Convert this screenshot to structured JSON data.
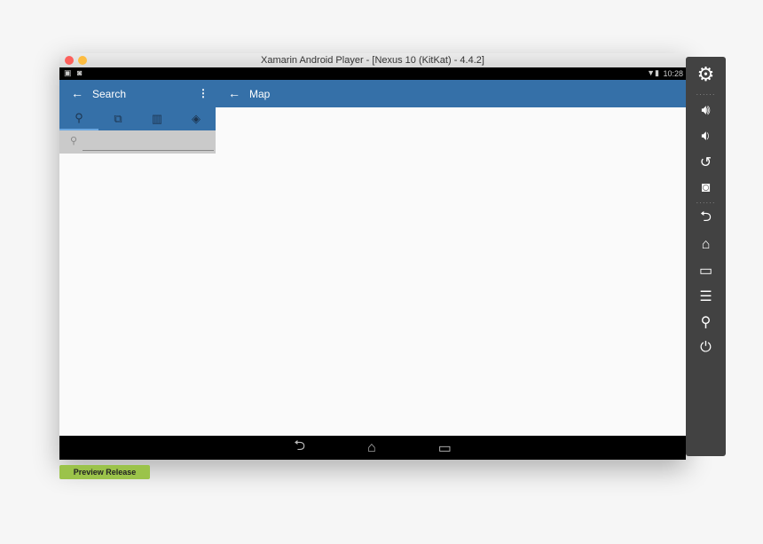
{
  "window": {
    "title": "Xamarin Android Player - [Nexus 10 (KitKat) - 4.4.2]"
  },
  "status_bar": {
    "time": "10:28"
  },
  "left_pane": {
    "title": "Search",
    "tabs": [
      "search-icon",
      "gallery-icon",
      "map-icon",
      "layers-icon"
    ],
    "search_placeholder": ""
  },
  "main": {
    "title": "Map"
  },
  "side_panel": {
    "buttons": [
      "settings",
      "volume-up",
      "volume-down",
      "rotate",
      "screenshot",
      "back",
      "home",
      "recent-apps",
      "menu",
      "search",
      "power"
    ]
  },
  "footer": {
    "preview_label": "Preview Release"
  },
  "colors": {
    "accent": "#3570a8",
    "badge": "#9bc34a"
  }
}
